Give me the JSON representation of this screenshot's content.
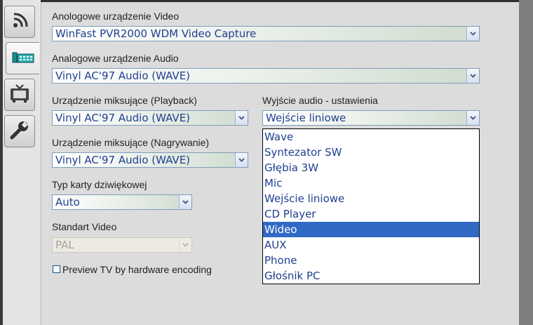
{
  "sidebar": {
    "tabs": [
      {
        "name": "broadcast-icon"
      },
      {
        "name": "video-capture-icon"
      },
      {
        "name": "tv-icon"
      },
      {
        "name": "wrench-icon"
      }
    ]
  },
  "video_device": {
    "label": "Anologowe urządzenie Video",
    "value": "WinFast PVR2000 WDM Video Capture"
  },
  "audio_device": {
    "label": "Analogowe urządzenie Audio",
    "value": "Vinyl AC'97 Audio (WAVE)"
  },
  "mixer_playback": {
    "label": "Urządzenie miksujące (Playback)",
    "value": "Vinyl AC'97 Audio (WAVE)"
  },
  "mixer_record": {
    "label": "Urządzenie miksujące (Nagrywanie)",
    "value": "Vinyl AC'97 Audio (WAVE)"
  },
  "sound_card_type": {
    "label": "Typ karty dziwiękowej",
    "value": "Auto"
  },
  "video_standard": {
    "label": "Standart Video",
    "value": "PAL"
  },
  "audio_output": {
    "label": "Wyjście audio - ustawienia",
    "value": "Wejście liniowe",
    "options": [
      "Wave",
      "Syntezator SW",
      "Głębia 3W",
      "Mic",
      "Wejście liniowe",
      "CD Player",
      "Wideo",
      "AUX",
      "Phone",
      "Głośnik PC"
    ],
    "highlighted": "Wideo"
  },
  "preview_checkbox": {
    "label": "Preview TV by hardware encoding",
    "checked": false
  },
  "colors": {
    "accent": "#316ac5",
    "text_value": "#1f3f8f"
  }
}
